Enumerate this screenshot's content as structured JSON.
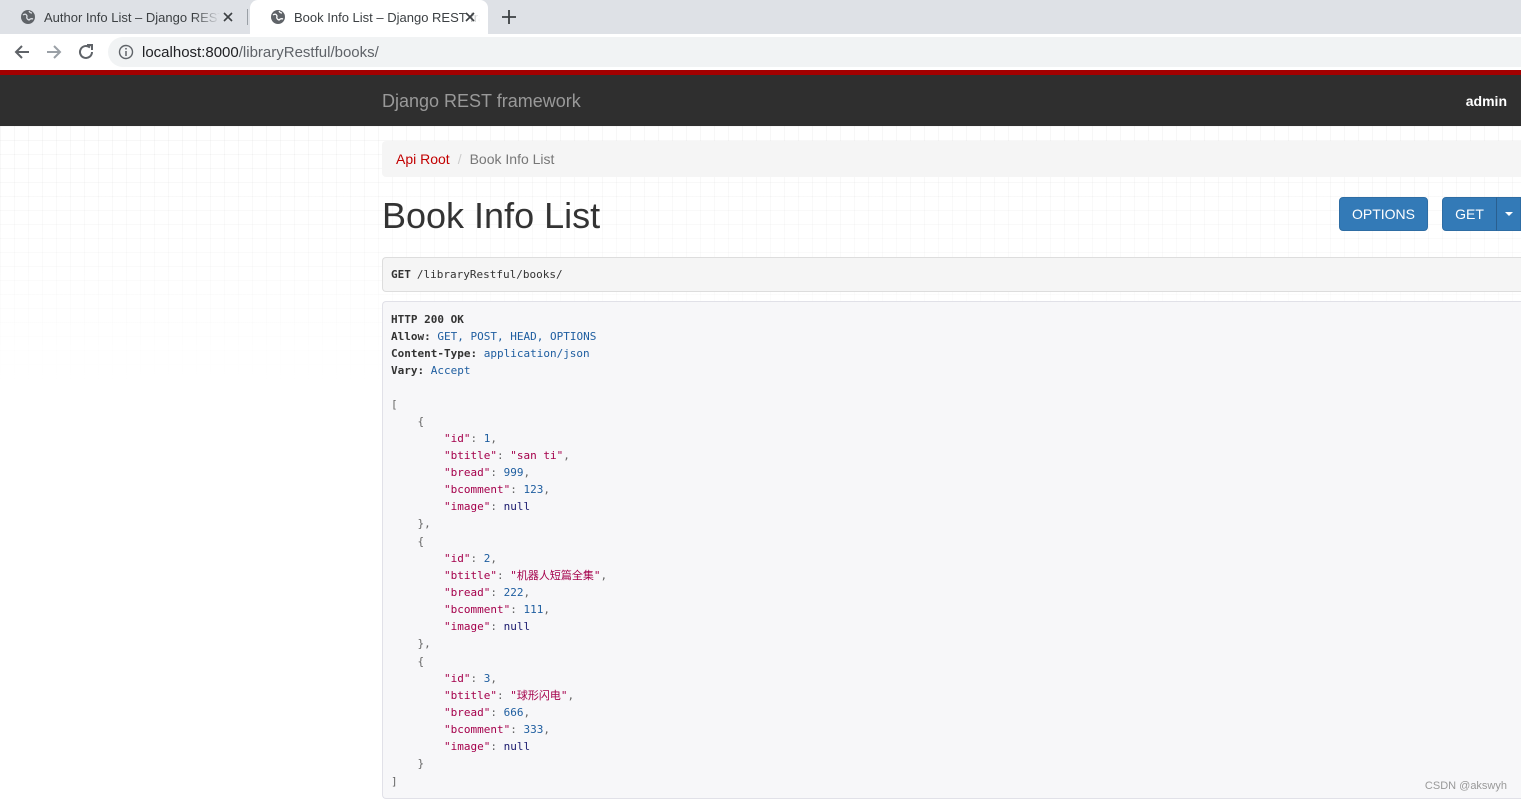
{
  "browser": {
    "tabs": [
      {
        "title": "Author Info List – Django REST framework",
        "active": false
      },
      {
        "title": "Book Info List – Django REST framework",
        "active": true
      }
    ],
    "url_host": "localhost:8000",
    "url_path": "/libraryRestful/books/"
  },
  "navbar": {
    "brand": "Django REST framework",
    "user": "admin"
  },
  "breadcrumb": {
    "root": "Api Root",
    "divider": "/",
    "current": "Book Info List"
  },
  "page": {
    "title": "Book Info List",
    "options_label": "OPTIONS",
    "get_label": "GET"
  },
  "request": {
    "method": "GET",
    "path": "/libraryRestful/books/"
  },
  "response": {
    "status": "HTTP 200 OK",
    "headers": [
      {
        "name": "Allow:",
        "value": "GET, POST, HEAD, OPTIONS"
      },
      {
        "name": "Content-Type:",
        "value": "application/json"
      },
      {
        "name": "Vary:",
        "value": "Accept"
      }
    ],
    "books": [
      {
        "id": "1",
        "btitle": "\"san ti\"",
        "bread": "999",
        "bcomment": "123",
        "image": "null"
      },
      {
        "id": "2",
        "btitle": "\"机器人短篇全集\"",
        "bread": "222",
        "bcomment": "111",
        "image": "null"
      },
      {
        "id": "3",
        "btitle": "\"球形闪电\"",
        "bread": "666",
        "bcomment": "333",
        "image": "null"
      }
    ]
  },
  "watermark": "CSDN @akswyh",
  "colors": {
    "navbar": "#2f2f2f",
    "accent_red": "#a30000",
    "button_blue": "#337ab7",
    "crumb_link": "#c20000"
  }
}
